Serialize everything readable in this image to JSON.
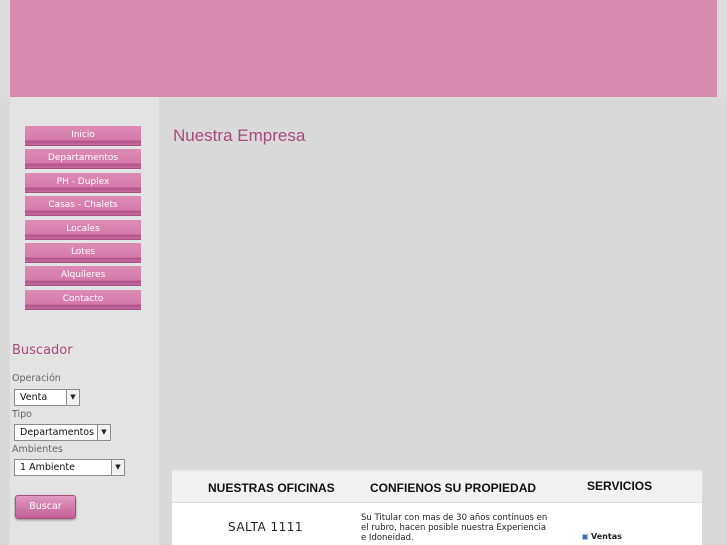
{
  "colors": {
    "accent": "#d78caf",
    "title": "#a94a7d",
    "nav": "#d67aa9"
  },
  "nav": {
    "items": [
      "Inicio",
      "Departamentos",
      "PH - Duplex",
      "Casas - Chalets",
      "Locales",
      "Lotes",
      "Alquileres",
      "Contacto"
    ]
  },
  "search": {
    "title": "Buscador",
    "operacion_label": "Operación",
    "operacion_value": "Venta",
    "tipo_label": "Tipo",
    "tipo_value": "Departamentos",
    "ambientes_label": "Ambientes",
    "ambientes_value": "1 Ambiente",
    "button": "Buscar"
  },
  "main": {
    "title": "Nuestra Empresa"
  },
  "info": {
    "col1": "NUESTRAS OFICINAS",
    "col2": "CONFIENOS SU PROPIEDAD",
    "col3": "SERVICIOS",
    "address": "SALTA 1111",
    "description": "Su Titular con mas de 30 años continuos en el rubro, hacen posible nuestra Experiencia e Idoneidad.",
    "service_1": "Ventas"
  }
}
